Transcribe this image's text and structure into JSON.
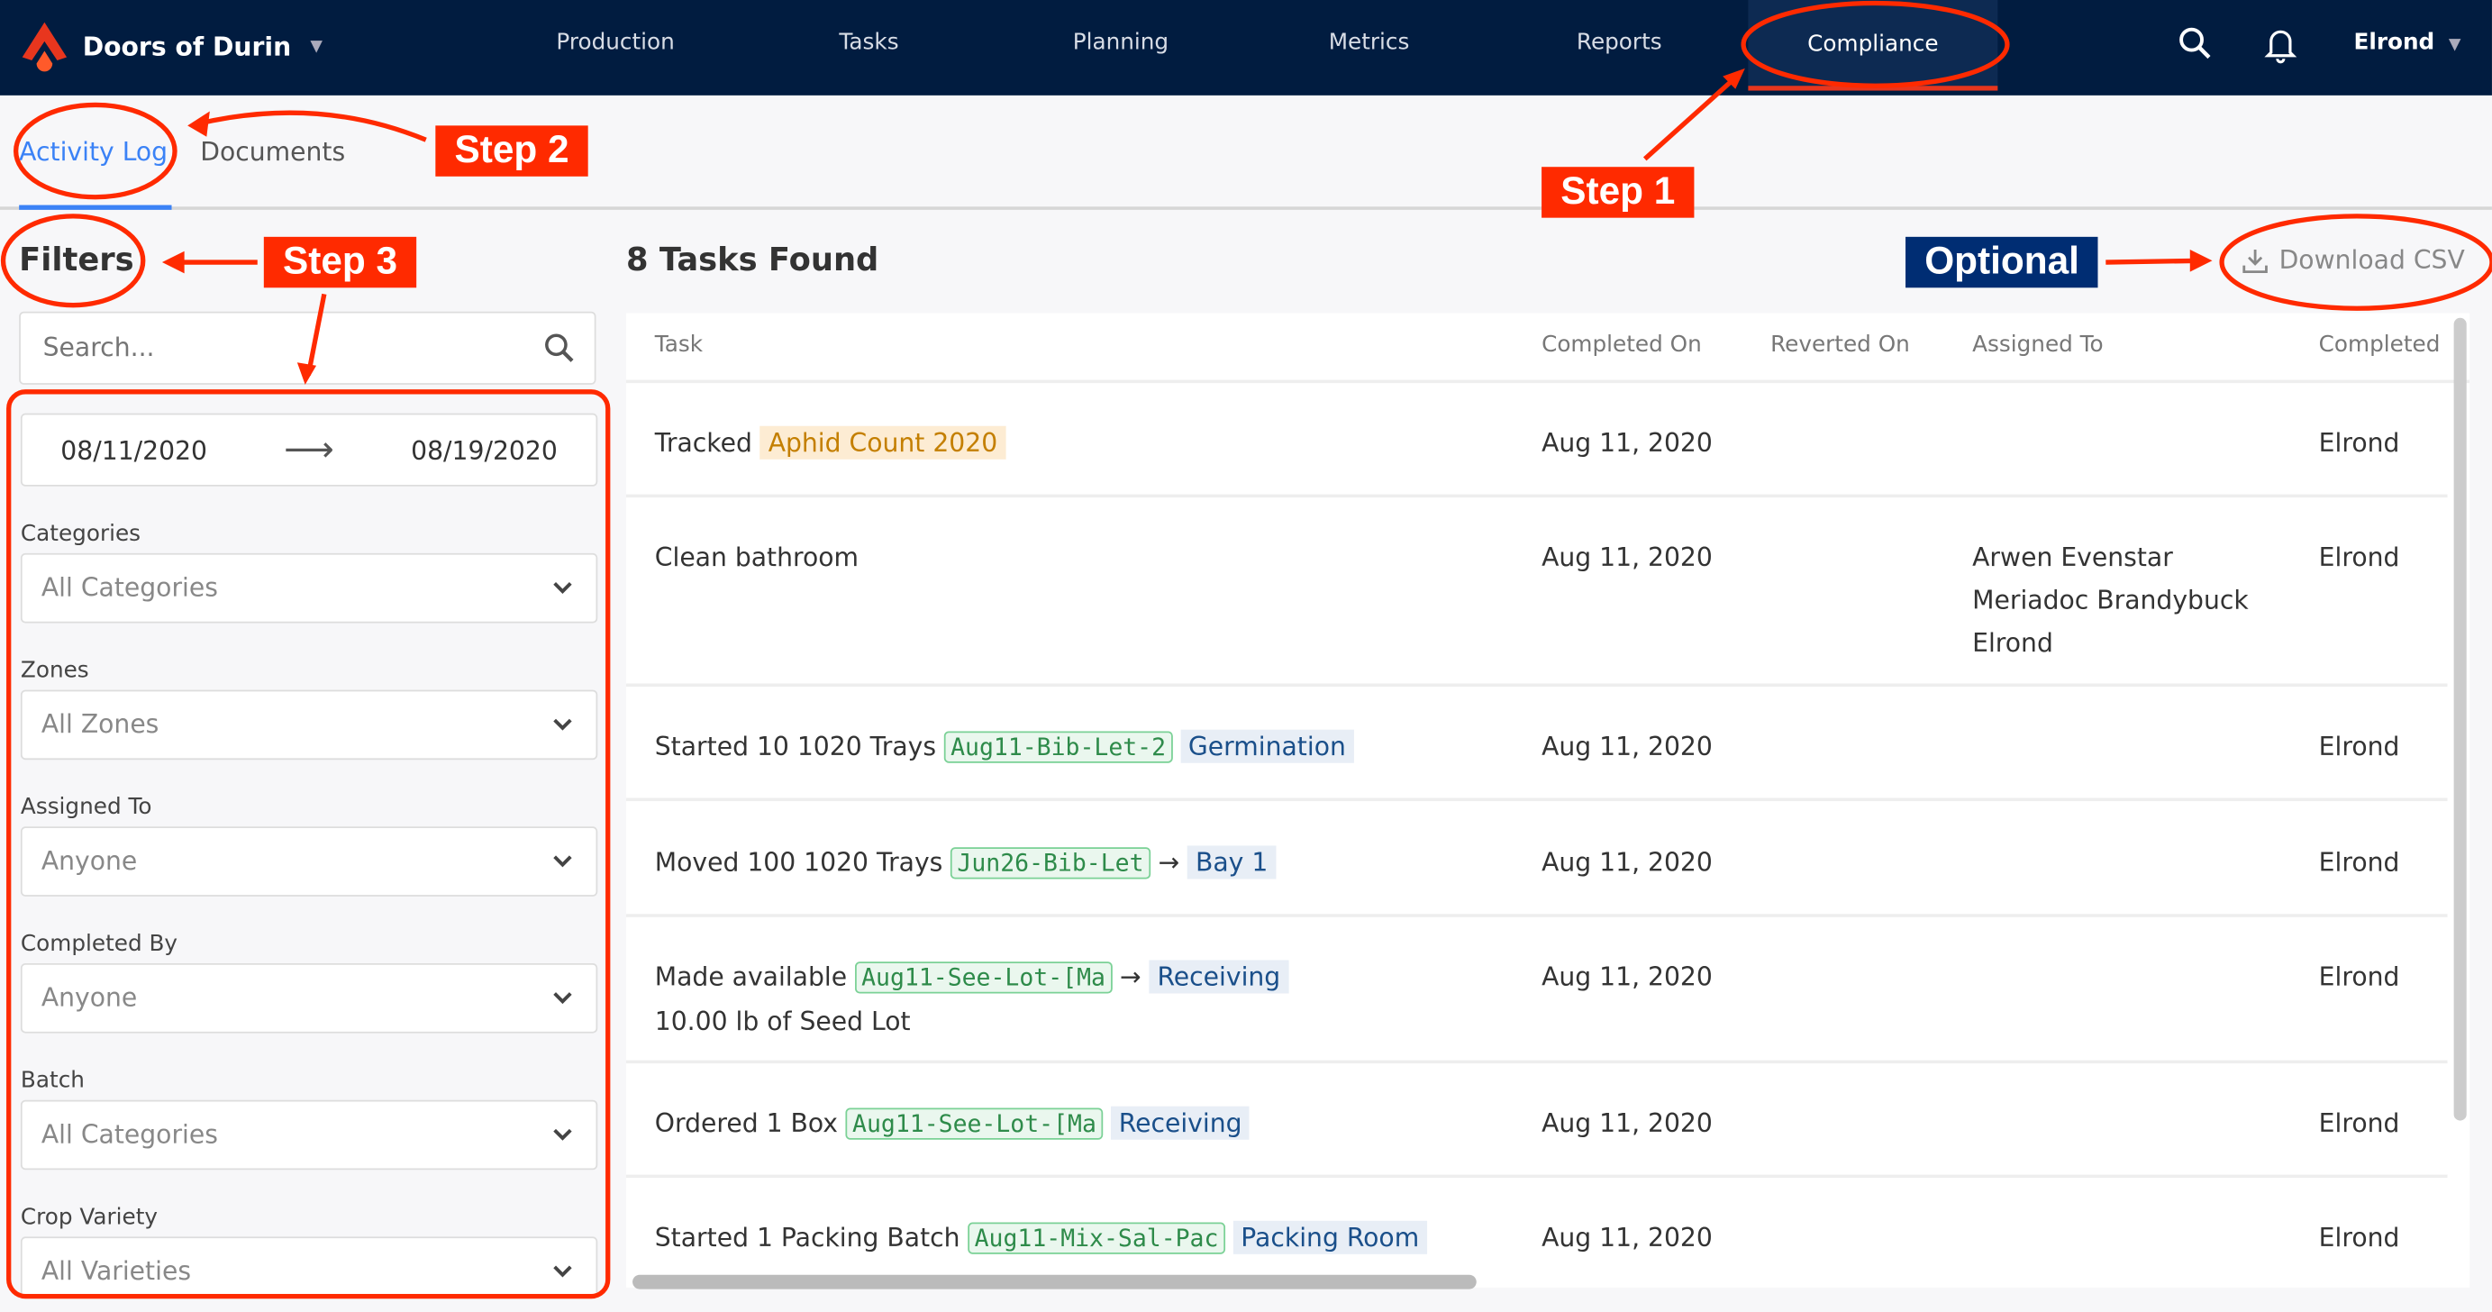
{
  "nav": {
    "brand": "Doors of Durin",
    "items": [
      "Production",
      "Tasks",
      "Planning",
      "Metrics",
      "Reports",
      "Compliance"
    ],
    "active": "Compliance",
    "user": "Elrond"
  },
  "tabs": [
    "Activity Log",
    "Documents"
  ],
  "filters": {
    "title": "Filters",
    "search_placeholder": "Search...",
    "date_from": "08/11/2020",
    "date_to": "08/19/2020",
    "fields": [
      {
        "label": "Categories",
        "value": "All Categories"
      },
      {
        "label": "Zones",
        "value": "All Zones"
      },
      {
        "label": "Assigned To",
        "value": "Anyone"
      },
      {
        "label": "Completed By",
        "value": "Anyone"
      },
      {
        "label": "Batch",
        "value": "All Categories"
      },
      {
        "label": "Crop Variety",
        "value": "All Varieties"
      }
    ]
  },
  "results": {
    "title": "8 Tasks Found",
    "download": "Download CSV",
    "columns": [
      "Task",
      "Completed On",
      "Reverted On",
      "Assigned To",
      "Completed"
    ],
    "rows": [
      {
        "pre": "Tracked",
        "tag": "Aphid Count 2020",
        "completed_on": "Aug 11, 2020",
        "assigned": [],
        "completed_by": "Elrond"
      },
      {
        "pre": "Clean bathroom",
        "completed_on": "Aug 11, 2020",
        "assigned": [
          "Arwen Evenstar",
          "Meriadoc Brandybuck",
          "Elrond"
        ],
        "completed_by": "Elrond"
      },
      {
        "pre": "Started 10 1020 Trays",
        "batch": "Aug11-Bib-Let-2",
        "location": "Germination",
        "completed_on": "Aug 11, 2020",
        "completed_by": "Elrond"
      },
      {
        "pre": "Moved 100 1020 Trays",
        "batch": "Jun26-Bib-Let",
        "arrow": "→",
        "location": "Bay 1",
        "completed_on": "Aug 11, 2020",
        "completed_by": "Elrond"
      },
      {
        "pre": "Made available",
        "batch": "Aug11-See-Lot-[Ma",
        "arrow": "→",
        "location": "Receiving",
        "line2": "10.00 lb of Seed Lot",
        "completed_on": "Aug 11, 2020",
        "completed_by": "Elrond"
      },
      {
        "pre": "Ordered 1 Box",
        "batch": "Aug11-See-Lot-[Ma",
        "location": "Receiving",
        "completed_on": "Aug 11, 2020",
        "completed_by": "Elrond"
      },
      {
        "pre": "Started 1 Packing Batch",
        "batch": "Aug11-Mix-Sal-Pac",
        "location": "Packing Room",
        "completed_on": "Aug 11, 2020",
        "completed_by": "Elrond"
      }
    ]
  },
  "annotations": {
    "step1": "Step 1",
    "step2": "Step 2",
    "step3": "Step 3",
    "optional": "Optional"
  },
  "colors": {
    "nav_bg": "#011c40",
    "accent": "#3b82f6",
    "annotation": "#ff2a00",
    "optional": "#002d73"
  }
}
